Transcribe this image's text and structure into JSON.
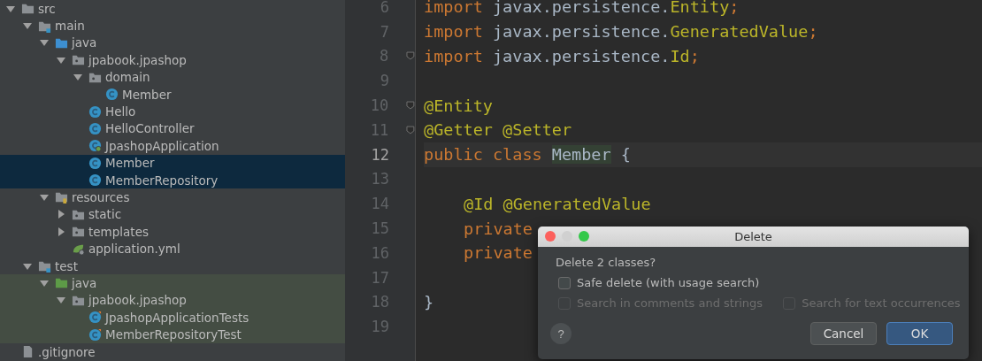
{
  "project_tree": [
    {
      "name": "src",
      "kind": "folder",
      "expanded": true,
      "selected": false,
      "children": [
        {
          "name": "main",
          "kind": "source-root",
          "expanded": true,
          "selected": false,
          "children": [
            {
              "name": "java",
              "kind": "source-folder",
              "expanded": true,
              "selected": false,
              "children": [
                {
                  "name": "jpabook.jpashop",
                  "kind": "package",
                  "expanded": true,
                  "selected": false,
                  "children": [
                    {
                      "name": "domain",
                      "kind": "package",
                      "expanded": true,
                      "selected": false,
                      "children": [
                        {
                          "name": "Member",
                          "kind": "class",
                          "selected": false
                        }
                      ]
                    },
                    {
                      "name": "Hello",
                      "kind": "class",
                      "selected": false
                    },
                    {
                      "name": "HelloController",
                      "kind": "class",
                      "selected": false
                    },
                    {
                      "name": "JpashopApplication",
                      "kind": "spring-class",
                      "selected": false
                    },
                    {
                      "name": "Member",
                      "kind": "class",
                      "selected": true
                    },
                    {
                      "name": "MemberRepository",
                      "kind": "class",
                      "selected": true
                    }
                  ]
                }
              ]
            },
            {
              "name": "resources",
              "kind": "resources-folder",
              "expanded": true,
              "selected": false,
              "children": [
                {
                  "name": "static",
                  "kind": "package",
                  "expanded": false,
                  "selected": false
                },
                {
                  "name": "templates",
                  "kind": "package",
                  "expanded": false,
                  "selected": false
                },
                {
                  "name": "application.yml",
                  "kind": "yml",
                  "selected": false
                }
              ]
            }
          ]
        },
        {
          "name": "test",
          "kind": "source-root",
          "expanded": true,
          "selected": false,
          "children": [
            {
              "name": "java",
              "kind": "test-folder",
              "expanded": true,
              "selected": false,
              "tinted": true,
              "children": [
                {
                  "name": "jpabook.jpashop",
                  "kind": "package",
                  "expanded": true,
                  "selected": false,
                  "children": [
                    {
                      "name": "JpashopApplicationTests",
                      "kind": "test-class",
                      "selected": false
                    },
                    {
                      "name": "MemberRepositoryTest",
                      "kind": "test-class",
                      "selected": false
                    }
                  ]
                }
              ]
            }
          ]
        }
      ]
    },
    {
      "name": ".gitignore",
      "kind": "file",
      "selected": false
    }
  ],
  "editor": {
    "lines": [
      {
        "number": "6",
        "current": false,
        "tokens": [
          {
            "text": "import",
            "kind": "keyword"
          },
          {
            "text": " javax.persistence.",
            "kind": "plain"
          },
          {
            "text": "Entity",
            "kind": "type"
          },
          {
            "text": ";",
            "kind": "keyword"
          }
        ]
      },
      {
        "number": "7",
        "current": false,
        "tokens": [
          {
            "text": "import",
            "kind": "keyword"
          },
          {
            "text": " javax.persistence.",
            "kind": "plain"
          },
          {
            "text": "GeneratedValue",
            "kind": "type"
          },
          {
            "text": ";",
            "kind": "keyword"
          }
        ]
      },
      {
        "number": "8",
        "current": false,
        "fold": true,
        "tokens": [
          {
            "text": "import",
            "kind": "keyword"
          },
          {
            "text": " javax.persistence.",
            "kind": "plain"
          },
          {
            "text": "Id",
            "kind": "type"
          },
          {
            "text": ";",
            "kind": "keyword"
          }
        ]
      },
      {
        "number": "9",
        "current": false
      },
      {
        "number": "10",
        "current": false,
        "fold": true,
        "tokens": [
          {
            "text": "@Entity",
            "kind": "annotation"
          }
        ]
      },
      {
        "number": "11",
        "current": false,
        "fold": true,
        "tokens": [
          {
            "text": "@Getter @Setter",
            "kind": "annotation"
          }
        ]
      },
      {
        "number": "12",
        "current": true,
        "tokens": [
          {
            "text": "public class ",
            "kind": "keyword"
          },
          {
            "text": "Member",
            "kind": "usage"
          },
          {
            "text": " {",
            "kind": "plain"
          }
        ]
      },
      {
        "number": "13",
        "current": false
      },
      {
        "number": "14",
        "current": false,
        "indent": true,
        "tokens": [
          {
            "text": "@Id @GeneratedValue",
            "kind": "annotation"
          }
        ]
      },
      {
        "number": "15",
        "current": false,
        "indent": true,
        "tokens": [
          {
            "text": "private",
            "kind": "keyword"
          }
        ]
      },
      {
        "number": "16",
        "current": false,
        "indent": true,
        "tokens": [
          {
            "text": "private",
            "kind": "keyword"
          }
        ]
      },
      {
        "number": "17",
        "current": false
      },
      {
        "number": "18",
        "current": false,
        "tokens": [
          {
            "text": "}",
            "kind": "plain"
          }
        ]
      },
      {
        "number": "19",
        "current": false
      }
    ]
  },
  "dialog": {
    "title": "Delete",
    "message": "Delete 2 classes?",
    "options": [
      {
        "label": "Safe delete (with usage search)",
        "checked": false,
        "disabled": false
      },
      {
        "label": "Search in comments and strings",
        "checked": false,
        "disabled": true
      },
      {
        "label": "Search for text occurrences",
        "checked": false,
        "disabled": true
      }
    ],
    "help": "?",
    "buttons": [
      {
        "label": "Cancel",
        "default": false
      },
      {
        "label": "OK",
        "default": true
      }
    ]
  }
}
